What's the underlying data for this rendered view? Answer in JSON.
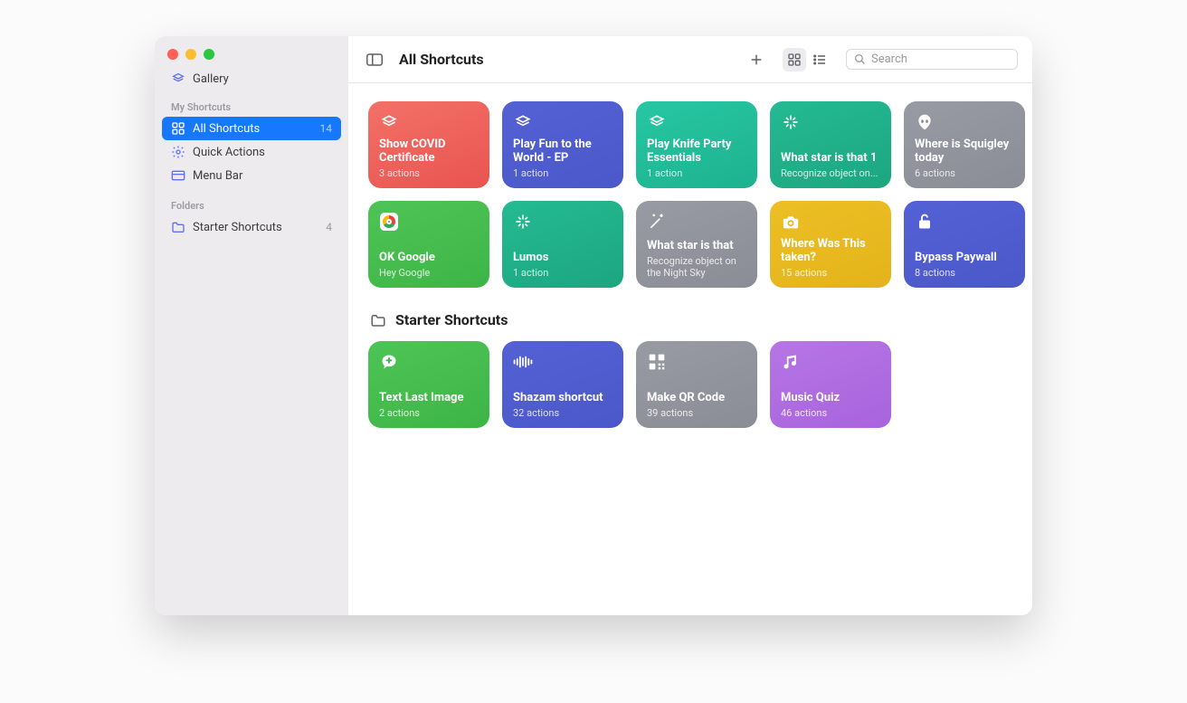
{
  "sidebar": {
    "gallery": "Gallery",
    "sections": [
      {
        "header": "My Shortcuts",
        "items": [
          {
            "id": "all",
            "label": "All Shortcuts",
            "icon": "grid",
            "count": "14",
            "selected": true
          },
          {
            "id": "quick",
            "label": "Quick Actions",
            "icon": "gear",
            "count": "",
            "selected": false
          },
          {
            "id": "menu",
            "label": "Menu Bar",
            "icon": "window",
            "count": "",
            "selected": false
          }
        ]
      },
      {
        "header": "Folders",
        "items": [
          {
            "id": "starter",
            "label": "Starter Shortcuts",
            "icon": "folder",
            "count": "4",
            "selected": false
          }
        ]
      }
    ]
  },
  "header": {
    "title": "All Shortcuts",
    "search_placeholder": "Search"
  },
  "shortcuts_main": [
    {
      "title": "Show COVID Certificate",
      "sub": "3 actions",
      "color": "g-red",
      "icon": "layers"
    },
    {
      "title": "Play Fun to the World - EP",
      "sub": "1 action",
      "color": "g-indigo",
      "icon": "layers"
    },
    {
      "title": "Play Knife Party Essentials",
      "sub": "1 action",
      "color": "g-tealA",
      "icon": "layers"
    },
    {
      "title": "What star is that 1",
      "sub": "Recognize object on...",
      "color": "g-tealB",
      "icon": "sparkle"
    },
    {
      "title": "Where is Squigley today",
      "sub": "6 actions",
      "color": "g-gray",
      "icon": "alien"
    },
    {
      "title": "OK Google",
      "sub": "Hey Google",
      "color": "g-green",
      "icon": "chrome"
    },
    {
      "title": "Lumos",
      "sub": "1 action",
      "color": "g-tealB",
      "icon": "sparkle"
    },
    {
      "title": "What star is that",
      "sub": "Recognize object on the Night Sky",
      "color": "g-gray",
      "icon": "wand"
    },
    {
      "title": "Where Was This taken?",
      "sub": "15 actions",
      "color": "g-yellow",
      "icon": "camera"
    },
    {
      "title": "Bypass Paywall",
      "sub": "8 actions",
      "color": "g-indigo",
      "icon": "lock"
    }
  ],
  "folder_section": {
    "title": "Starter Shortcuts"
  },
  "shortcuts_folder": [
    {
      "title": "Text Last Image",
      "sub": "2 actions",
      "color": "g-green",
      "icon": "chatplus"
    },
    {
      "title": "Shazam shortcut",
      "sub": "32 actions",
      "color": "g-indigo",
      "icon": "wave"
    },
    {
      "title": "Make QR Code",
      "sub": "39 actions",
      "color": "g-gray",
      "icon": "qr"
    },
    {
      "title": "Music Quiz",
      "sub": "46 actions",
      "color": "g-purple",
      "icon": "note"
    }
  ]
}
